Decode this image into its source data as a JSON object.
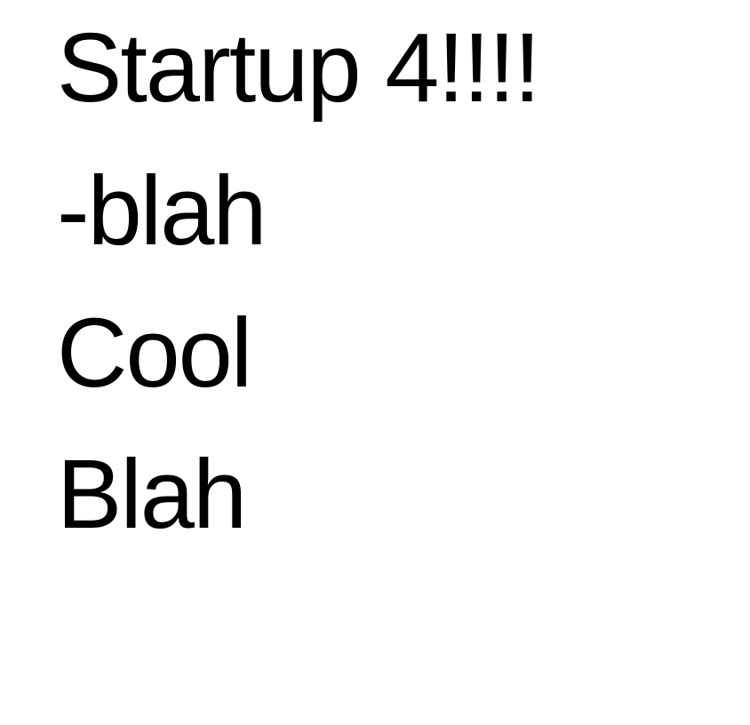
{
  "document": {
    "lines": [
      "Startup 4!!!!",
      "-blah",
      "Cool",
      "Blah"
    ],
    "text_color": "#000000",
    "background_color": "#ffffff"
  }
}
